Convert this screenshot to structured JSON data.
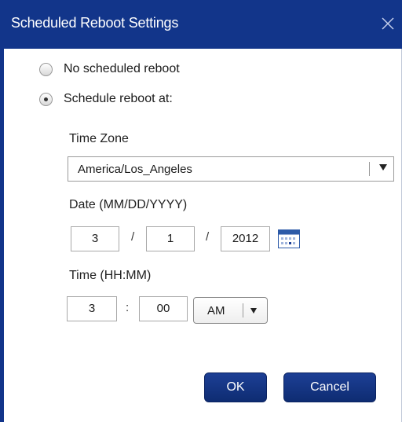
{
  "dialog": {
    "title": "Scheduled Reboot Settings"
  },
  "options": {
    "no_reboot_label": "No scheduled reboot",
    "schedule_label": "Schedule reboot at:",
    "selected": "schedule"
  },
  "timezone": {
    "label": "Time Zone",
    "value": "America/Los_Angeles"
  },
  "date": {
    "label": "Date (MM/DD/YYYY)",
    "month": "3",
    "day": "1",
    "year": "2012",
    "separator": "/"
  },
  "time": {
    "label": "Time (HH:MM)",
    "hour": "3",
    "minute": "00",
    "separator": ":",
    "ampm": "AM"
  },
  "buttons": {
    "ok": "OK",
    "cancel": "Cancel"
  },
  "colors": {
    "titlebar": "#12358a",
    "button": "#0e2c72"
  },
  "icons": {
    "close": "close-icon",
    "calendar": "calendar-icon",
    "dropdown": "chevron-down-icon"
  }
}
